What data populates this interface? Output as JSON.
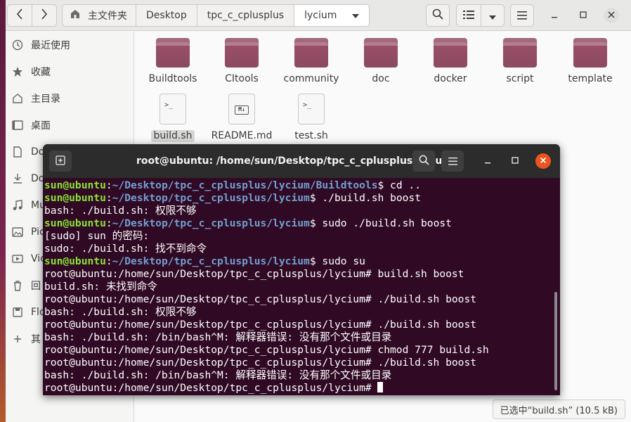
{
  "file_manager": {
    "breadcrumbs": [
      "主文件夹",
      "Desktop",
      "tpc_c_cplusplus",
      "lycium"
    ],
    "sidebar": [
      {
        "label": "最近使用",
        "icon": "clock-icon"
      },
      {
        "label": "收藏",
        "icon": "star-icon"
      },
      {
        "label": "主目录",
        "icon": "home-icon"
      },
      {
        "label": "桌面",
        "icon": "desktop-icon"
      },
      {
        "label": "Do",
        "icon": "document-icon"
      },
      {
        "label": "Do",
        "icon": "download-icon"
      },
      {
        "label": "Mu",
        "icon": "music-icon"
      },
      {
        "label": "Pic",
        "icon": "picture-icon"
      },
      {
        "label": "Vic",
        "icon": "video-icon"
      },
      {
        "label": "回",
        "icon": "trash-icon"
      },
      {
        "label": "Flo",
        "icon": "floppy-icon"
      },
      {
        "label": "其",
        "icon": "plus-icon"
      }
    ],
    "folders": [
      "Buildtools",
      "CItools",
      "community",
      "doc",
      "docker",
      "script",
      "template"
    ],
    "files": [
      {
        "name": "build.sh",
        "icon": "terminal-script-icon"
      },
      {
        "name": "README.md",
        "icon": "markdown-icon"
      },
      {
        "name": "test.sh",
        "icon": "terminal-script-icon"
      }
    ],
    "status": "已选中“build.sh” (10.5 kB)"
  },
  "terminal": {
    "title": "root@ubuntu: /home/sun/Desktop/tpc_c_cplusplus/lycium",
    "lines": [
      {
        "user": "sun@ubuntu",
        "path": "~/Desktop/tpc_c_cplusplus/lycium/Buildtools",
        "cmd": "$ cd .."
      },
      {
        "user": "sun@ubuntu",
        "path": "~/Desktop/tpc_c_cplusplus/lycium",
        "cmd": "$ ./build.sh boost"
      },
      {
        "text": "bash: ./build.sh: 权限不够"
      },
      {
        "user": "sun@ubuntu",
        "path": "~/Desktop/tpc_c_cplusplus/lycium",
        "cmd": "$ sudo ./build.sh boost"
      },
      {
        "text": "[sudo] sun 的密码:"
      },
      {
        "text": "sudo: ./build.sh: 找不到命令"
      },
      {
        "user": "sun@ubuntu",
        "path": "~/Desktop/tpc_c_cplusplus/lycium",
        "cmd": "$ sudo su"
      },
      {
        "text": "root@ubuntu:/home/sun/Desktop/tpc_c_cplusplus/lycium# build.sh boost"
      },
      {
        "text": "build.sh: 未找到命令"
      },
      {
        "text": "root@ubuntu:/home/sun/Desktop/tpc_c_cplusplus/lycium# ./build.sh boost"
      },
      {
        "text": "bash: ./build.sh: 权限不够"
      },
      {
        "text": "root@ubuntu:/home/sun/Desktop/tpc_c_cplusplus/lycium# ./build.sh boost"
      },
      {
        "text": "bash: ./build.sh: /bin/bash^M: 解释器错误: 没有那个文件或目录"
      },
      {
        "text": "root@ubuntu:/home/sun/Desktop/tpc_c_cplusplus/lycium# chmod 777 build.sh"
      },
      {
        "text": "root@ubuntu:/home/sun/Desktop/tpc_c_cplusplus/lycium# ./build.sh boost"
      },
      {
        "text": "bash: ./build.sh: /bin/bash^M: 解释器错误: 没有那个文件或目录"
      },
      {
        "text": "root@ubuntu:/home/sun/Desktop/tpc_c_cplusplus/lycium# ",
        "cursor": true
      }
    ]
  },
  "colors": {
    "terminal_bg": "#300a24",
    "prompt_user": "#8ae234",
    "prompt_path": "#729fcf",
    "folder": "#9a4f69",
    "close_button": "#e95420"
  }
}
